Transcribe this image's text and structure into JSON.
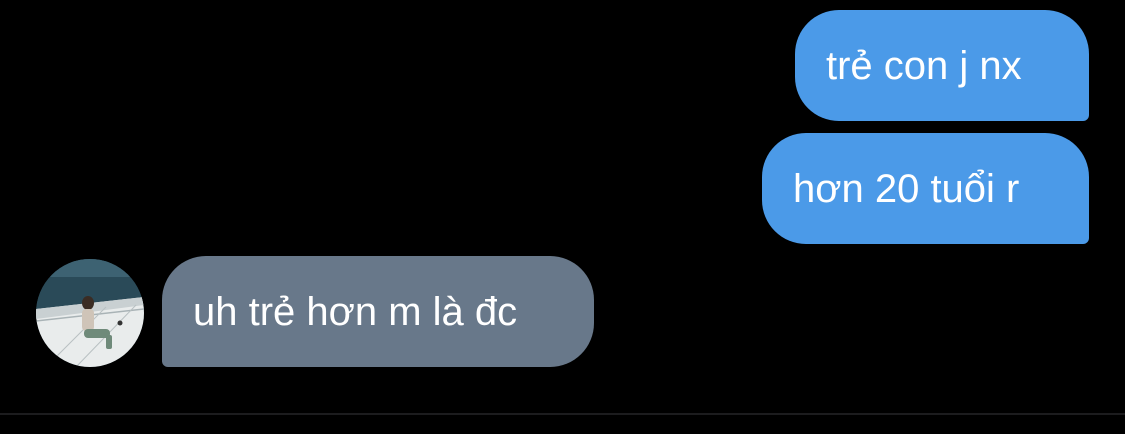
{
  "conversation": {
    "messages": [
      {
        "sender": "me",
        "text": "trẻ con j nx"
      },
      {
        "sender": "me",
        "text": "hơn 20 tuổi r"
      },
      {
        "sender": "other",
        "text": "uh trẻ hơn m là đc"
      }
    ]
  },
  "colors": {
    "background": "#000000",
    "outgoing_bubble": "#4b9ae8",
    "incoming_bubble": "#68788a",
    "text": "#ffffff"
  }
}
